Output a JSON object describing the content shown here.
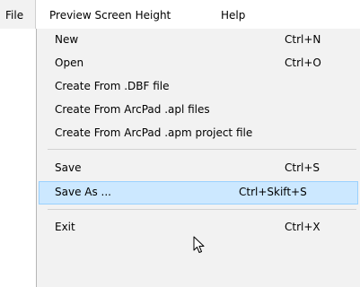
{
  "menubar": {
    "file": "File",
    "preview": "Preview Screen Height",
    "help": "Help"
  },
  "file_menu": {
    "items": [
      {
        "label": "New",
        "shortcut": "Ctrl+N"
      },
      {
        "label": "Open",
        "shortcut": "Ctrl+O"
      },
      {
        "label": "Create From .DBF file",
        "shortcut": ""
      },
      {
        "label": "Create From ArcPad .apl  files",
        "shortcut": ""
      },
      {
        "label": "Create From ArcPad .apm project file",
        "shortcut": ""
      },
      {
        "label": "Save",
        "shortcut": "Ctrl+S"
      },
      {
        "label": "Save As ...",
        "shortcut": "Ctrl+Skift+S"
      },
      {
        "label": "Exit",
        "shortcut": "Ctrl+X"
      }
    ]
  },
  "colors": {
    "menu_bg": "#f2f2f2",
    "highlight_bg": "#cce8ff",
    "highlight_border": "#99d1ff",
    "separator": "#d2d2d2"
  }
}
